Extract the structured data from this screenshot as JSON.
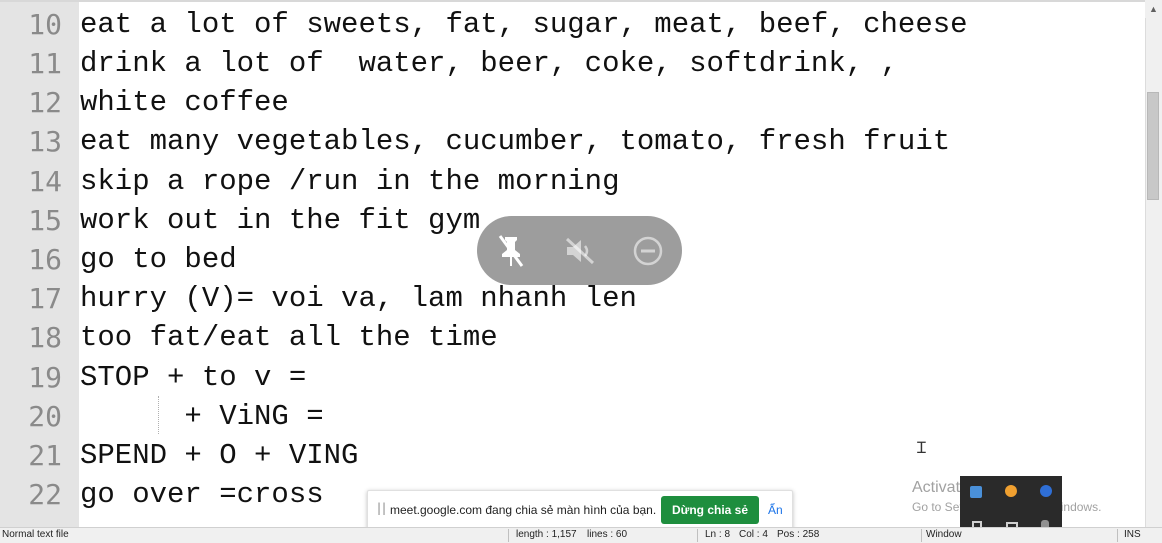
{
  "editor": {
    "lines": [
      {
        "num": "10",
        "text": "eat a lot of sweets, fat, sugar, meat, beef, cheese"
      },
      {
        "num": "11",
        "text": "drink a lot of  water, beer, coke, softdrink, ,"
      },
      {
        "num": "12",
        "text": "white coffee"
      },
      {
        "num": "13",
        "text": "eat many vegetables, cucumber, tomato, fresh fruit"
      },
      {
        "num": "14",
        "text": "skip a rope /run in the morning"
      },
      {
        "num": "15",
        "text": "work out in the fit gym"
      },
      {
        "num": "16",
        "text": "go to bed"
      },
      {
        "num": "17",
        "text": "hurry (V)= voi va, lam nhanh len"
      },
      {
        "num": "18",
        "text": "too fat/eat all the time"
      },
      {
        "num": "19",
        "text": "STOP + to v ="
      },
      {
        "num": "20",
        "text": "      + ViNG ="
      },
      {
        "num": "21",
        "text": "SPEND + O + VING"
      },
      {
        "num": "22",
        "text": "go over =cross"
      }
    ]
  },
  "statusbar": {
    "file_type": "Normal text file",
    "length": "length : 1,157",
    "lines": "lines : 60",
    "ln": "Ln : 8",
    "col": "Col : 4",
    "pos": "Pos : 258",
    "eol": "Window",
    "ins": "INS"
  },
  "meet_controls": {
    "icons": [
      "unpin-icon",
      "mute-icon",
      "remove-icon"
    ]
  },
  "share_bar": {
    "handle": "||",
    "message": "meet.google.com đang chia sẻ màn hình của bạn.",
    "stop_label": "Dừng chia sẻ",
    "hide_label": "Ẩn"
  },
  "watermark": {
    "line1": "Activate Windows",
    "line2": "Go to Settings to activate Windows."
  },
  "colors": {
    "gutter": "#e4e4e4",
    "line_number": "#8a8a8a",
    "stop_share": "#1e8e3e",
    "link": "#1a73e8"
  }
}
